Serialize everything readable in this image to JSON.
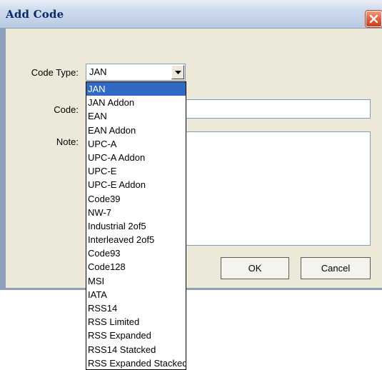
{
  "window": {
    "title": "Add Code"
  },
  "form": {
    "code_type_label": "Code Type:",
    "code_type_value": "JAN",
    "code_label": "Code:",
    "code_value": "",
    "note_label": "Note:",
    "note_value": ""
  },
  "buttons": {
    "ok": "OK",
    "cancel": "Cancel"
  },
  "dropdown": {
    "selected": "JAN",
    "options": [
      "JAN",
      "JAN Addon",
      "EAN",
      "EAN Addon",
      "UPC-A",
      "UPC-A Addon",
      "UPC-E",
      "UPC-E Addon",
      "Code39",
      "NW-7",
      "Industrial 2of5",
      "Interleaved 2of5",
      "Code93",
      "Code128",
      "MSI",
      "IATA",
      "RSS14",
      "RSS Limited",
      "RSS Expanded",
      "RSS14 Statcked",
      "RSS Expanded Stacked"
    ]
  },
  "icons": {
    "close": "close-icon",
    "dropdown_arrow": "chevron-down-icon"
  },
  "colors": {
    "title_text": "#0b2a6e",
    "close_button": "#e25c37",
    "selection": "#316ac5",
    "dialog_face": "#ece9d8"
  }
}
